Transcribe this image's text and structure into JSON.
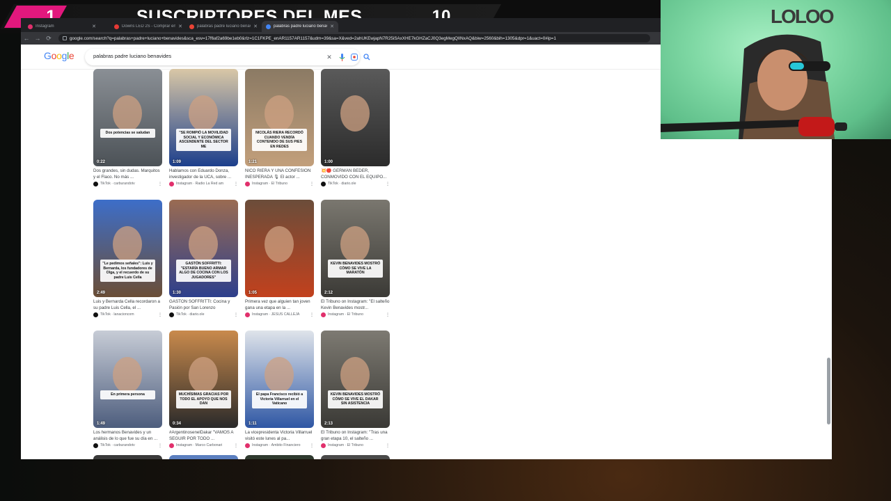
{
  "overlay": {
    "rank": "1",
    "title": "SUSCRIPTORES DEL MES",
    "count": "10",
    "badge_color": "#e2187d"
  },
  "browser": {
    "tabs": [
      {
        "label": "Instagram",
        "active": false
      },
      {
        "label": "Downs LED 2S - Comprar en L...",
        "active": false
      },
      {
        "label": "palabras padre luciano benav...",
        "active": false
      },
      {
        "label": "palabras padre luciano benav...",
        "active": true
      }
    ],
    "url": "google.com/search?q=palabras+padre+luciano+benavides&sca_esv=17f6af2a69be1eb0&rlz=1C1FKPE_enAR1157AR1157&udm=39&sa=X&ved=2ahUKEwjapN7R25iSAxXHE7kGHZaCJ0Q3egMegQIlNxAQ&biw=2560&bih=1305&dpr=1&uact=0#ip=1"
  },
  "google": {
    "logo": "Google",
    "query": "palabras padre luciano benavides"
  },
  "results": [
    {
      "duration": "0:22",
      "caption": "Dos grandes, sin dudas. Marquitos y el Flaco. No más ...",
      "source": "TikTok · carburandotv",
      "platform": "tiktok",
      "overlay": "Dos potencias se saludan",
      "bg": [
        "#8a8f95",
        "#4c5257"
      ]
    },
    {
      "duration": "1:09",
      "caption": "Hablamos con Eduardo Donza, investigador de la UCA, sobre ...",
      "source": "Instagram · Radio La Red am",
      "platform": "instagram",
      "overlay": "\"SE ROMPIÓ LA MOVILIDAD SOCIAL Y ECONÓMICA ASCENDENTE DEL SECTOR ME",
      "bg": [
        "#d9c7a6",
        "#1c3f8c"
      ]
    },
    {
      "duration": "1:21",
      "caption": "NICO RIERA Y UNA CONFESIÓN INESPERADA 🎙 El actor ...",
      "source": "Instagram · El Tribuno",
      "platform": "instagram",
      "overlay": "NICOLÁS RIERA RECORDÓ CUANDO VENDÍA CONTENIDO DE SUS PIES EN REDES",
      "bg": [
        "#8b7a64",
        "#c29f7b"
      ]
    },
    {
      "duration": "1:00",
      "caption": "💥🔴 GERMÁN BEDER, CONMOVIDO CON EL EQUIPO...",
      "source": "TikTok · diario.ole",
      "platform": "tiktok",
      "overlay": "",
      "bg": [
        "#5a5a5a",
        "#2b2b2b"
      ]
    },
    {
      "duration": "2:49",
      "caption": "Luis y Bernarda Cella recordaron a su padre Luis Cella, el ...",
      "source": "TikTok · lanacioncom",
      "platform": "tiktok",
      "overlay": "\"Le pedimos señales\": Luis y Bernarda, los fundadores de Olga, y el recuerdo de su padre Luis Cella",
      "bg": [
        "#3d6ec9",
        "#6b4e36"
      ]
    },
    {
      "duration": "1:30",
      "caption": "GASTÓN SOFFRITTI: Cocina y Pasión por San Lorenzo",
      "source": "TikTok · diario.ole",
      "platform": "tiktok",
      "overlay": "GASTÓN SOFFRITTI: \"ESTARÍA BUENO ARMAR ALGO DE COCINA CON LOS JUGADORES\"",
      "bg": [
        "#9a6b52",
        "#2d3f8c"
      ]
    },
    {
      "duration": "1:05",
      "caption": "Primera vez que alguien tan joven gana una etapa en la ...",
      "source": "Instagram · JESÚS CALLEJA",
      "platform": "instagram",
      "overlay": "",
      "bg": [
        "#6b4d3a",
        "#c2411d"
      ]
    },
    {
      "duration": "2:12",
      "caption": "El Tribuno on Instagram: \"El salteño Kevin Benavides mostr...",
      "source": "Instagram · El Tribuno",
      "platform": "instagram",
      "overlay": "KEVIN BENAVIDES MOSTRÓ CÓMO SE VIVE LA MARATÓN",
      "bg": [
        "#7a776f",
        "#3b3a36"
      ]
    },
    {
      "duration": "1:49",
      "caption": "Los hermanos Benavides y un análisis de lo que fue su día en ...",
      "source": "TikTok · carburandotv",
      "platform": "tiktok",
      "overlay": "En primera persona",
      "bg": [
        "#c7ccd6",
        "#4d5d7d"
      ]
    },
    {
      "duration": "0:34",
      "caption": "#ArgentinosenelDakar \"VAMOS A SEGUIR POR TODO ...",
      "source": "Instagram · Marco Carbonari",
      "platform": "instagram",
      "overlay": "MUCHÍSIMAS GRACIAS POR TODO EL APOYO QUE NOS DAN",
      "bg": [
        "#c98a4c",
        "#2a2a2a"
      ]
    },
    {
      "duration": "1:11",
      "caption": "La vicepresidenta Victoria Villarruel visitó este lunes al pa...",
      "source": "Instagram · Ámbito Financiero",
      "platform": "instagram",
      "overlay": "El papa Francisco recibió a Victoria Villarruel en el Vaticano",
      "bg": [
        "#dfe4ea",
        "#2f57a4"
      ]
    },
    {
      "duration": "2:13",
      "caption": "El Tribuno on Instagram: \"Tras una gran etapa 10, el salteño ...",
      "source": "Instagram · El Tribuno",
      "platform": "instagram",
      "overlay": "KEVIN BENAVIDES MOSTRÓ CÓMO SE VIVE EL DAKAR SIN ASISTENCIA",
      "bg": [
        "#7d7a72",
        "#3a3935"
      ]
    }
  ],
  "colors": {
    "tiktok": "#111111",
    "instagram": "#e1306c",
    "google_blue": "#4285f4",
    "google_red": "#ea4335",
    "google_yellow": "#fbbc05",
    "google_green": "#34a853"
  },
  "webcam": {
    "logo": "LOLOO"
  }
}
